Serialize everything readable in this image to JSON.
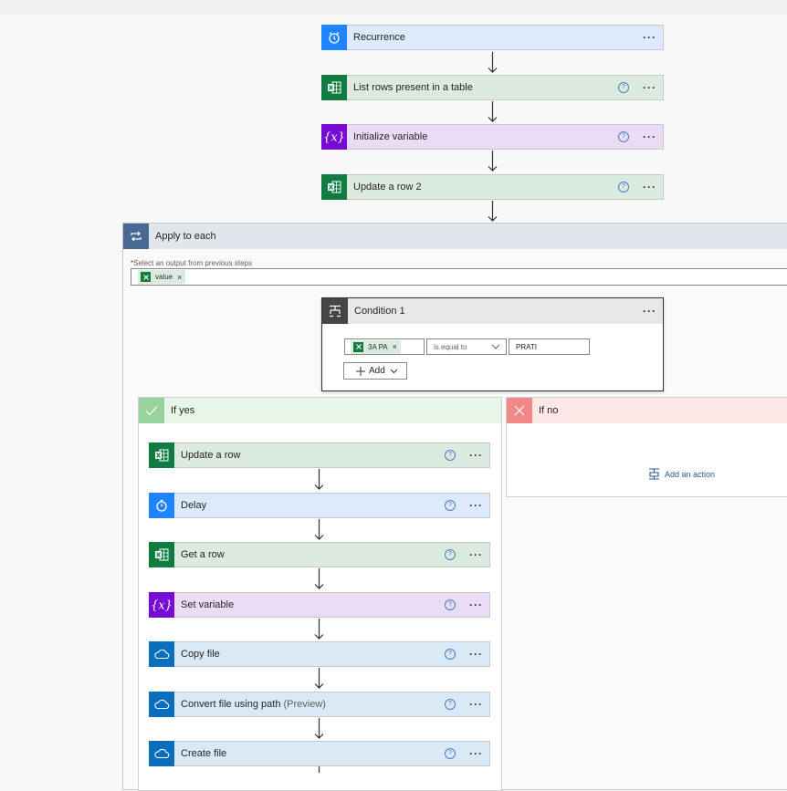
{
  "flow": {
    "top_steps": [
      {
        "title": "Recurrence",
        "icon": "alarm-clock-icon",
        "color": "blue",
        "help": false
      },
      {
        "title": "List rows present in a table",
        "icon": "excel-icon",
        "color": "green",
        "help": true
      },
      {
        "title": "Initialize variable",
        "icon": "variable-icon",
        "color": "purple",
        "help": true
      },
      {
        "title": "Update a row 2",
        "icon": "excel-icon",
        "color": "green",
        "help": true
      }
    ],
    "more_label": "···",
    "help_label": "?"
  },
  "apply_each": {
    "title": "Apply to each",
    "select_required": "*",
    "select_label": "Select an output from previous steps",
    "token": "value",
    "token_remove": "×"
  },
  "condition": {
    "title": "Condition 1",
    "left_token": "3A PA",
    "operator": "is equal to",
    "right_value": "PRATI",
    "add_label": "Add"
  },
  "if_yes": {
    "title": "If yes",
    "steps": [
      {
        "title": "Update a row",
        "icon": "excel-icon",
        "color": "green"
      },
      {
        "title": "Delay",
        "icon": "timer-icon",
        "color": "blue"
      },
      {
        "title": "Get a row",
        "icon": "excel-icon",
        "color": "green"
      },
      {
        "title": "Set variable",
        "icon": "variable-icon",
        "color": "purple"
      },
      {
        "title": "Copy file",
        "icon": "onedrive-icon",
        "color": "sky"
      },
      {
        "title": "Convert file using path",
        "suffix": "(Preview)",
        "icon": "onedrive-icon",
        "color": "sky"
      },
      {
        "title": "Create file",
        "icon": "onedrive-icon",
        "color": "sky"
      }
    ]
  },
  "if_no": {
    "title": "If no",
    "add_action": "Add an action"
  },
  "colors": {
    "blue": "#1f85ff",
    "green": "#107c41",
    "purple": "#770bd6",
    "sky": "#0a6ebd",
    "yes": "#9ad29e",
    "no": "#f1898a"
  }
}
